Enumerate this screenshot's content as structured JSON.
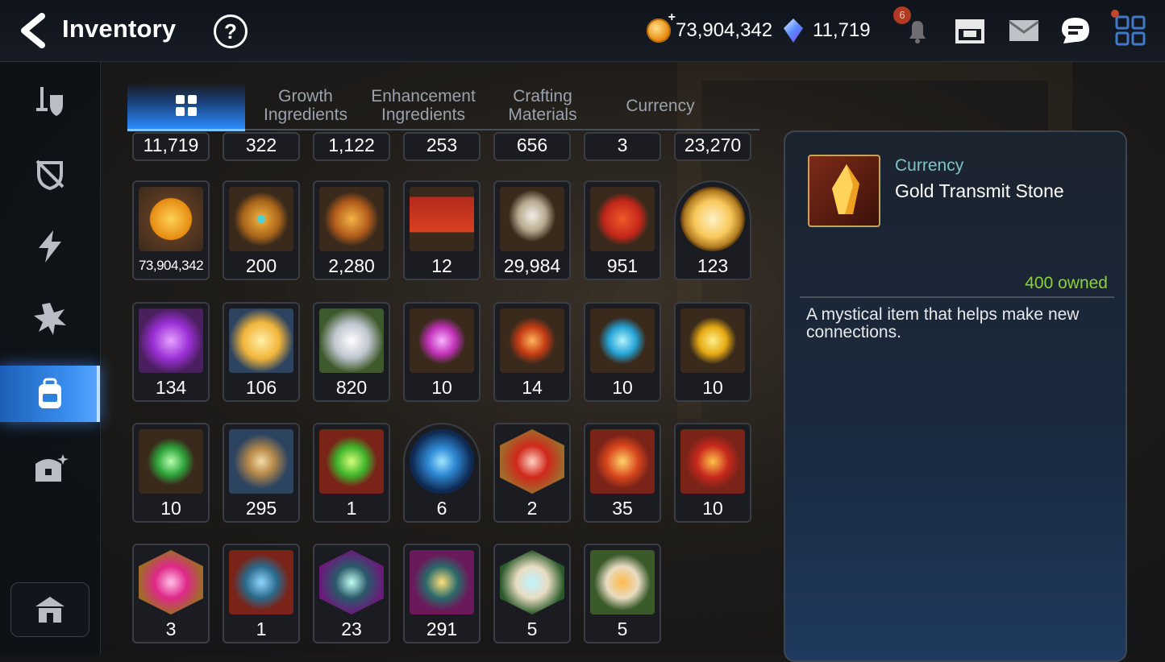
{
  "header": {
    "title": "Inventory",
    "help_label": "?",
    "gold": "73,904,342",
    "crystals": "11,719",
    "notification_count": "6"
  },
  "tabs": [
    {
      "label": ""
    },
    {
      "label": "Growth\nIngredients"
    },
    {
      "label": "Enhancement\nIngredients"
    },
    {
      "label": "Crafting\nMaterials"
    },
    {
      "label": "Currency"
    }
  ],
  "grid": {
    "row0": [
      "11,719",
      "322",
      "1,122",
      "253",
      "656",
      "3",
      "23,270"
    ],
    "row1": [
      "73,904,342",
      "200",
      "2,280",
      "12",
      "29,984",
      "951",
      "123"
    ],
    "row2": [
      "134",
      "106",
      "820",
      "10",
      "14",
      "10",
      "10"
    ],
    "row3": [
      "10",
      "295",
      "1",
      "6",
      "2",
      "35",
      "10"
    ],
    "row4": [
      "3",
      "1",
      "23",
      "291",
      "5",
      "5"
    ]
  },
  "detail": {
    "category": "Currency",
    "name": "Gold Transmit Stone",
    "owned": "400 owned",
    "description": "A mystical item that helps make new connections."
  },
  "colors": {
    "accent_blue": "#3b8ff0",
    "owned_green": "#8bd13a",
    "category_teal": "#7fc3c7"
  }
}
